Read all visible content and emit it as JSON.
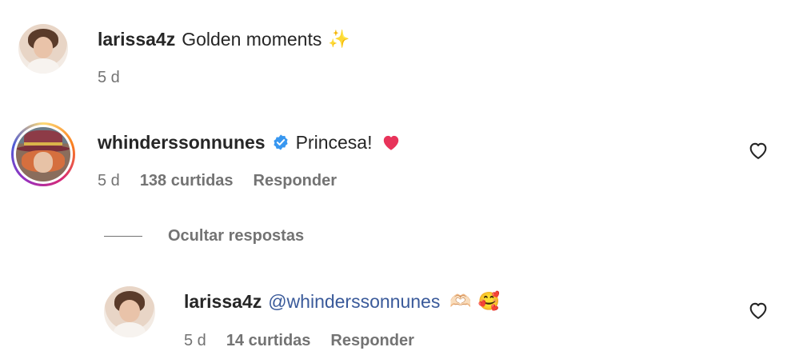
{
  "comments": [
    {
      "username": "larissa4z",
      "text": "Golden moments",
      "emoji": "✨",
      "time": "5 d"
    },
    {
      "username": "whinderssonnunes",
      "verified": true,
      "text": "Princesa!",
      "emoji": "❤️",
      "time": "5 d",
      "likes": "138 curtidas",
      "reply_label": "Responder",
      "hide_replies_label": "Ocultar respostas",
      "replies": [
        {
          "username": "larissa4z",
          "mention": "@whinderssonnunes",
          "emoji1": "🫶🏻",
          "emoji2": "🥰",
          "time": "5 d",
          "likes": "14 curtidas",
          "reply_label": "Responder"
        }
      ]
    }
  ],
  "icons": {
    "like": "heart-outline-icon",
    "verified": "verified-badge-icon"
  },
  "colors": {
    "text": "#262626",
    "secondary": "#737373",
    "mention": "#3a5a9a",
    "verified": "#3897f0",
    "heart_emoji": "#e8335a"
  }
}
